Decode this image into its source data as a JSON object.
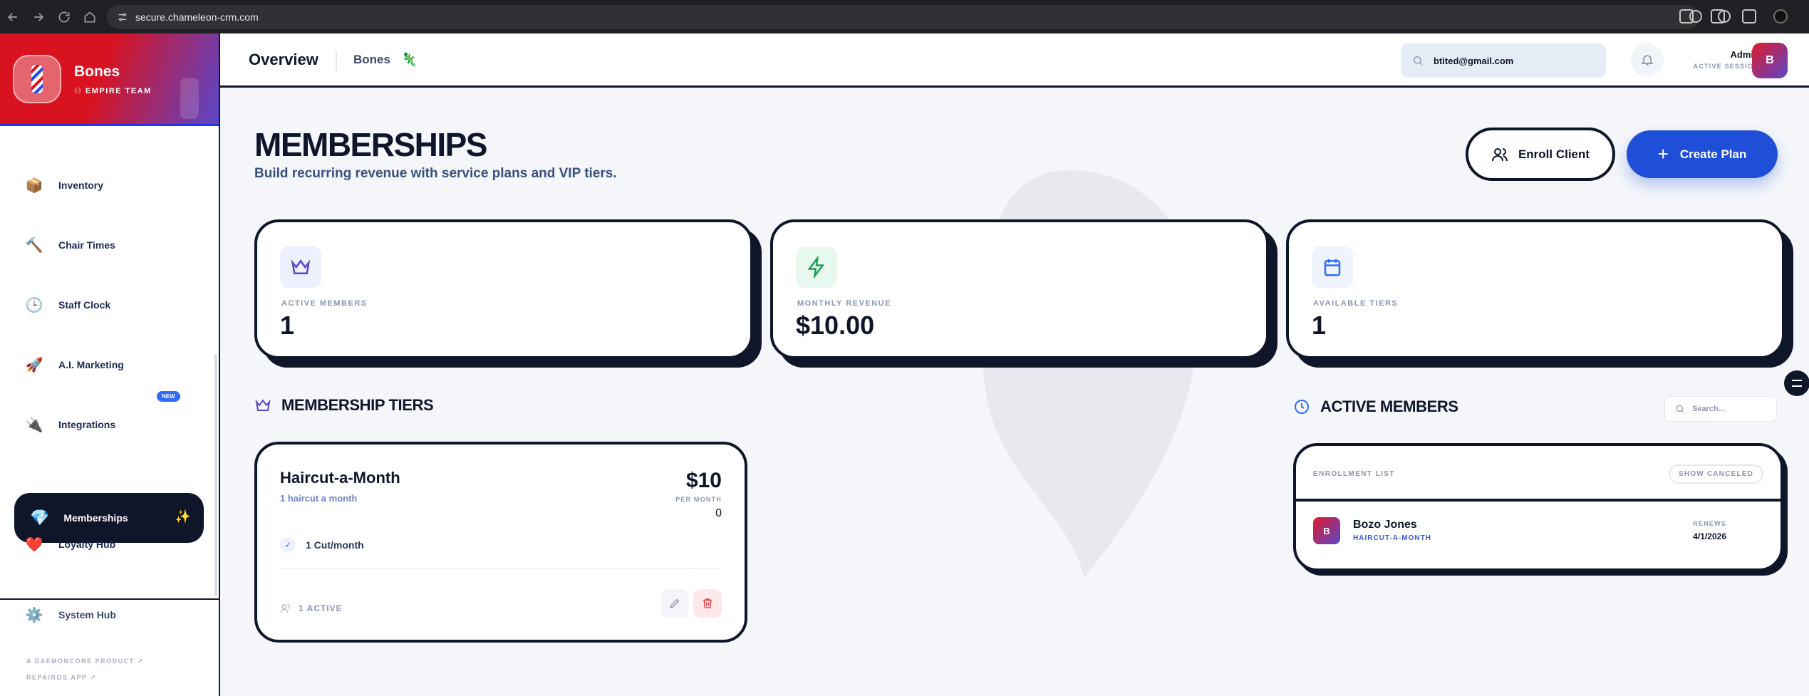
{
  "browser": {
    "url": "secure.chameleon-crm.com"
  },
  "sidebar": {
    "brand_name": "Bones",
    "brand_team": "EMPIRE TEAM",
    "items": [
      {
        "label": "Inventory",
        "icon": "package-icon"
      },
      {
        "label": "Chair Times",
        "icon": "hammer-icon"
      },
      {
        "label": "Staff Clock",
        "icon": "clock-icon"
      },
      {
        "label": "A.I. Marketing",
        "icon": "rocket-icon",
        "badge": "NEW"
      },
      {
        "label": "Integrations",
        "icon": "plug-icon"
      },
      {
        "label": "Memberships",
        "icon": "gem-icon",
        "active": true
      },
      {
        "label": "Loyalty Hub",
        "icon": "heart-icon"
      }
    ],
    "system_hub": "System Hub",
    "footer_line1": "A DAEMONCORE PRODUCT",
    "footer_line2": "REPAIROS.APP"
  },
  "header": {
    "title": "Overview",
    "subtitle": "Bones",
    "search_value": "btited@gmail.com",
    "user_name": "Admin",
    "user_status": "ACTIVE SESSION",
    "avatar_letter": "B"
  },
  "page": {
    "title": "MEMBERSHIPS",
    "subtitle": "Build recurring revenue with service plans and VIP tiers.",
    "enroll_label": "Enroll Client",
    "create_label": "Create Plan"
  },
  "stats": [
    {
      "label": "ACTIVE MEMBERS",
      "value": "1",
      "icon": "crown-icon",
      "color": "#5b46c9"
    },
    {
      "label": "MONTHLY REVENUE",
      "value": "$10.00",
      "icon": "lightning-icon",
      "color": "#1f9d55"
    },
    {
      "label": "AVAILABLE TIERS",
      "value": "1",
      "icon": "calendar-icon",
      "color": "#2f6bff"
    }
  ],
  "tiers_section": {
    "title": "MEMBERSHIP TIERS",
    "tiers": [
      {
        "name": "Haircut-a-Month",
        "description": "1 haircut a month",
        "price": "$10",
        "period": "PER MONTH",
        "extra": "0",
        "features": [
          "1 Cut/month"
        ],
        "active_count": "1 ACTIVE"
      }
    ]
  },
  "members_section": {
    "title": "ACTIVE MEMBERS",
    "search_placeholder": "Search...",
    "list_title": "ENROLLMENT LIST",
    "show_canceled": "SHOW CANCELED",
    "members": [
      {
        "initial": "B",
        "name": "Bozo Jones",
        "plan": "HAIRCUT-A-MONTH",
        "renews_label": "RENEWS",
        "renews_date": "4/1/2026"
      }
    ]
  }
}
